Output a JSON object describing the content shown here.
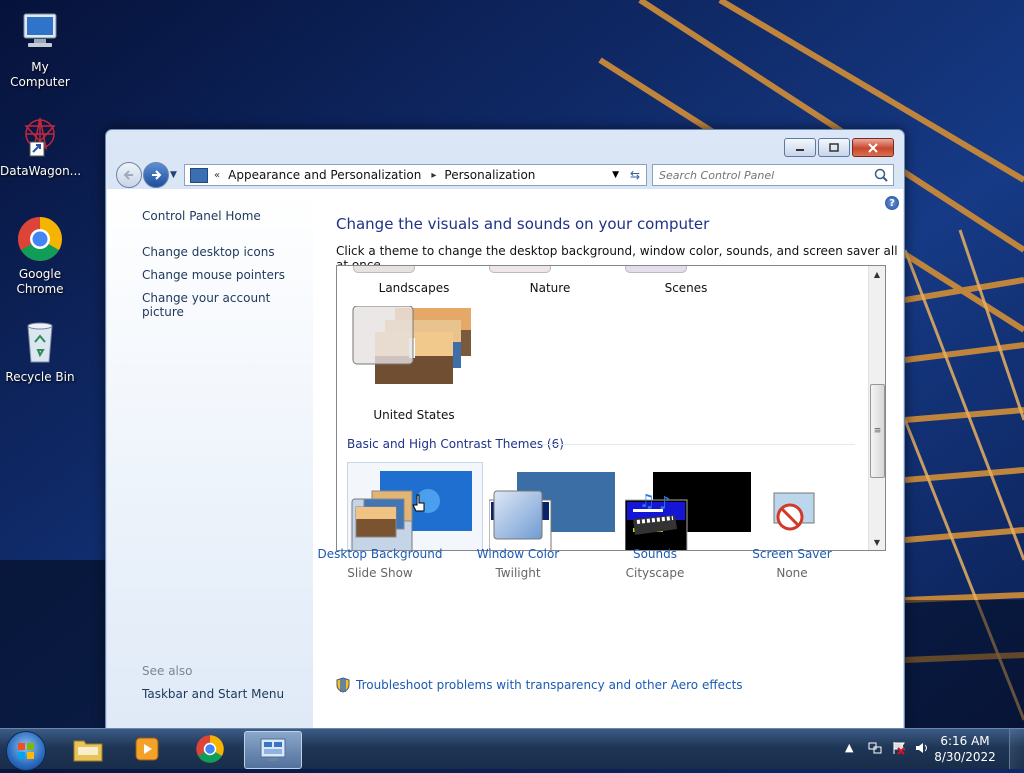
{
  "desktop": {
    "icons": [
      {
        "label": "My Computer"
      },
      {
        "label": "DataWagon..."
      },
      {
        "label": "Google Chrome"
      },
      {
        "label": "Recycle Bin"
      }
    ]
  },
  "window": {
    "title": "",
    "address": {
      "prefix": "«",
      "crumbs": [
        "Appearance and Personalization",
        "Personalization"
      ]
    },
    "search_placeholder": "Search Control Panel",
    "left_pane": {
      "home": "Control Panel Home",
      "links": [
        "Change desktop icons",
        "Change mouse pointers",
        "Change your account picture"
      ],
      "see_also_label": "See also",
      "see_also_links": [
        "Taskbar and Start Menu"
      ]
    },
    "main": {
      "heading": "Change the visuals and sounds on your computer",
      "subheading": "Click a theme to change the desktop background, window color, sounds, and screen saver all at once.",
      "top_theme_labels": [
        "Landscapes",
        "Nature",
        "Scenes"
      ],
      "installed_theme": "United States",
      "basic_section": "Basic and High Contrast Themes (6)",
      "bottom_items": [
        {
          "label": "Desktop Background",
          "value": "Slide Show"
        },
        {
          "label": "Window Color",
          "value": "Twilight"
        },
        {
          "label": "Sounds",
          "value": "Cityscape"
        },
        {
          "label": "Screen Saver",
          "value": "None"
        }
      ],
      "troubleshoot": "Troubleshoot problems with transparency and other Aero effects"
    }
  },
  "taskbar": {
    "time": "6:16 AM",
    "date": "8/30/2022"
  },
  "colors": {
    "link": "#1b5ab3",
    "heading": "#1e3287"
  }
}
